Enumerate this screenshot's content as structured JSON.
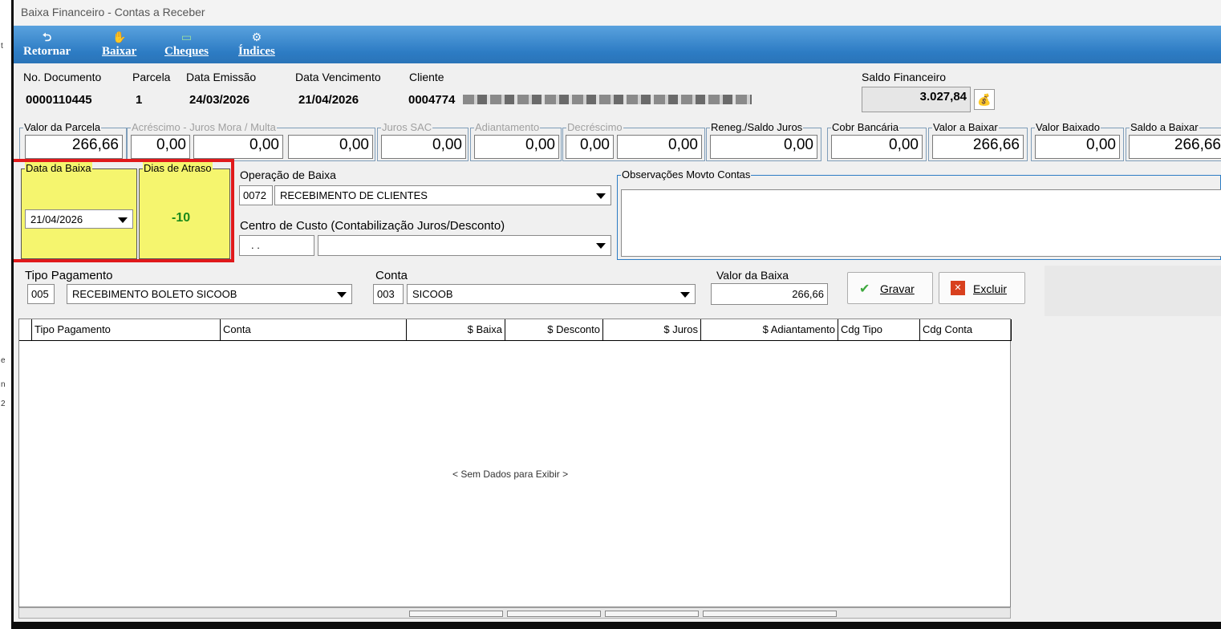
{
  "window": {
    "title": "Baixa Financeiro - Contas a Receber"
  },
  "toolbar": [
    {
      "label": "Retornar",
      "icon": "return-arrow-icon"
    },
    {
      "label": "Baixar",
      "icon": "hand-coin-icon"
    },
    {
      "label": "Cheques",
      "icon": "check-icon"
    },
    {
      "label": "Índices",
      "icon": "gear-icon"
    }
  ],
  "header": {
    "doc_label": "No. Documento",
    "doc_value": "0000110445",
    "parcela_label": "Parcela",
    "parcela_value": "1",
    "emissao_label": "Data Emissão",
    "emissao_value": "24/03/2026",
    "vencimento_label": "Data Vencimento",
    "vencimento_value": "21/04/2026",
    "cliente_label": "Cliente",
    "cliente_code": "0004774",
    "saldo_label": "Saldo Financeiro",
    "saldo_value": "3.027,84"
  },
  "values_row": {
    "valor_parcela": {
      "label": "Valor da Parcela",
      "value": "266,66"
    },
    "acrescimo": {
      "label": "Acréscimo - Juros Mora / Multa",
      "values": [
        "0,00",
        "0,00",
        "0,00"
      ]
    },
    "juros_sac": {
      "label": "Juros SAC",
      "value": "0,00"
    },
    "adiantamento": {
      "label": "Adiantamento",
      "value": "0,00"
    },
    "decrescimo": {
      "label": "Decréscimo",
      "values": [
        "0,00",
        "0,00"
      ]
    },
    "reneg": {
      "label": "Reneg./Saldo Juros",
      "value": "0,00"
    },
    "cobr": {
      "label": "Cobr Bancária",
      "value": "0,00"
    },
    "valor_baixar": {
      "label": "Valor a Baixar",
      "value": "266,66"
    },
    "valor_baixado": {
      "label": "Valor Baixado",
      "value": "0,00"
    },
    "saldo_baixar": {
      "label": "Saldo a Baixar",
      "value": "266,66"
    }
  },
  "baixa": {
    "data_label": "Data da Baixa",
    "data_value": "21/04/2026",
    "dias_label": "Dias de Atraso",
    "dias_value": "-10",
    "operacao_label": "Operação de Baixa",
    "operacao_code": "0072",
    "operacao_value": "RECEBIMENTO DE CLIENTES",
    "centro_label": "Centro de Custo (Contabilização Juros/Desconto)",
    "centro_code": ". .",
    "obs_label": "Observações Movto Contas"
  },
  "pagamento": {
    "tipo_label": "Tipo Pagamento",
    "tipo_code": "005",
    "tipo_value": "RECEBIMENTO BOLETO SICOOB",
    "conta_label": "Conta",
    "conta_code": "003",
    "conta_value": "SICOOB",
    "valor_label": "Valor da Baixa",
    "valor_value": "266,66",
    "gravar_label": "Gravar",
    "excluir_label": "Excluir"
  },
  "grid": {
    "columns": [
      "",
      "Tipo Pagamento",
      "Conta",
      "$ Baixa",
      "$ Desconto",
      "$ Juros",
      "$ Adiantamento",
      "Cdg Tipo",
      "Cdg Conta"
    ],
    "empty_text": "< Sem Dados para Exibir >"
  },
  "colors": {
    "accent": "#2d7cc4",
    "highlight": "#f5f56e",
    "frame": "#e0191b",
    "dias": "#1a8a1a"
  }
}
